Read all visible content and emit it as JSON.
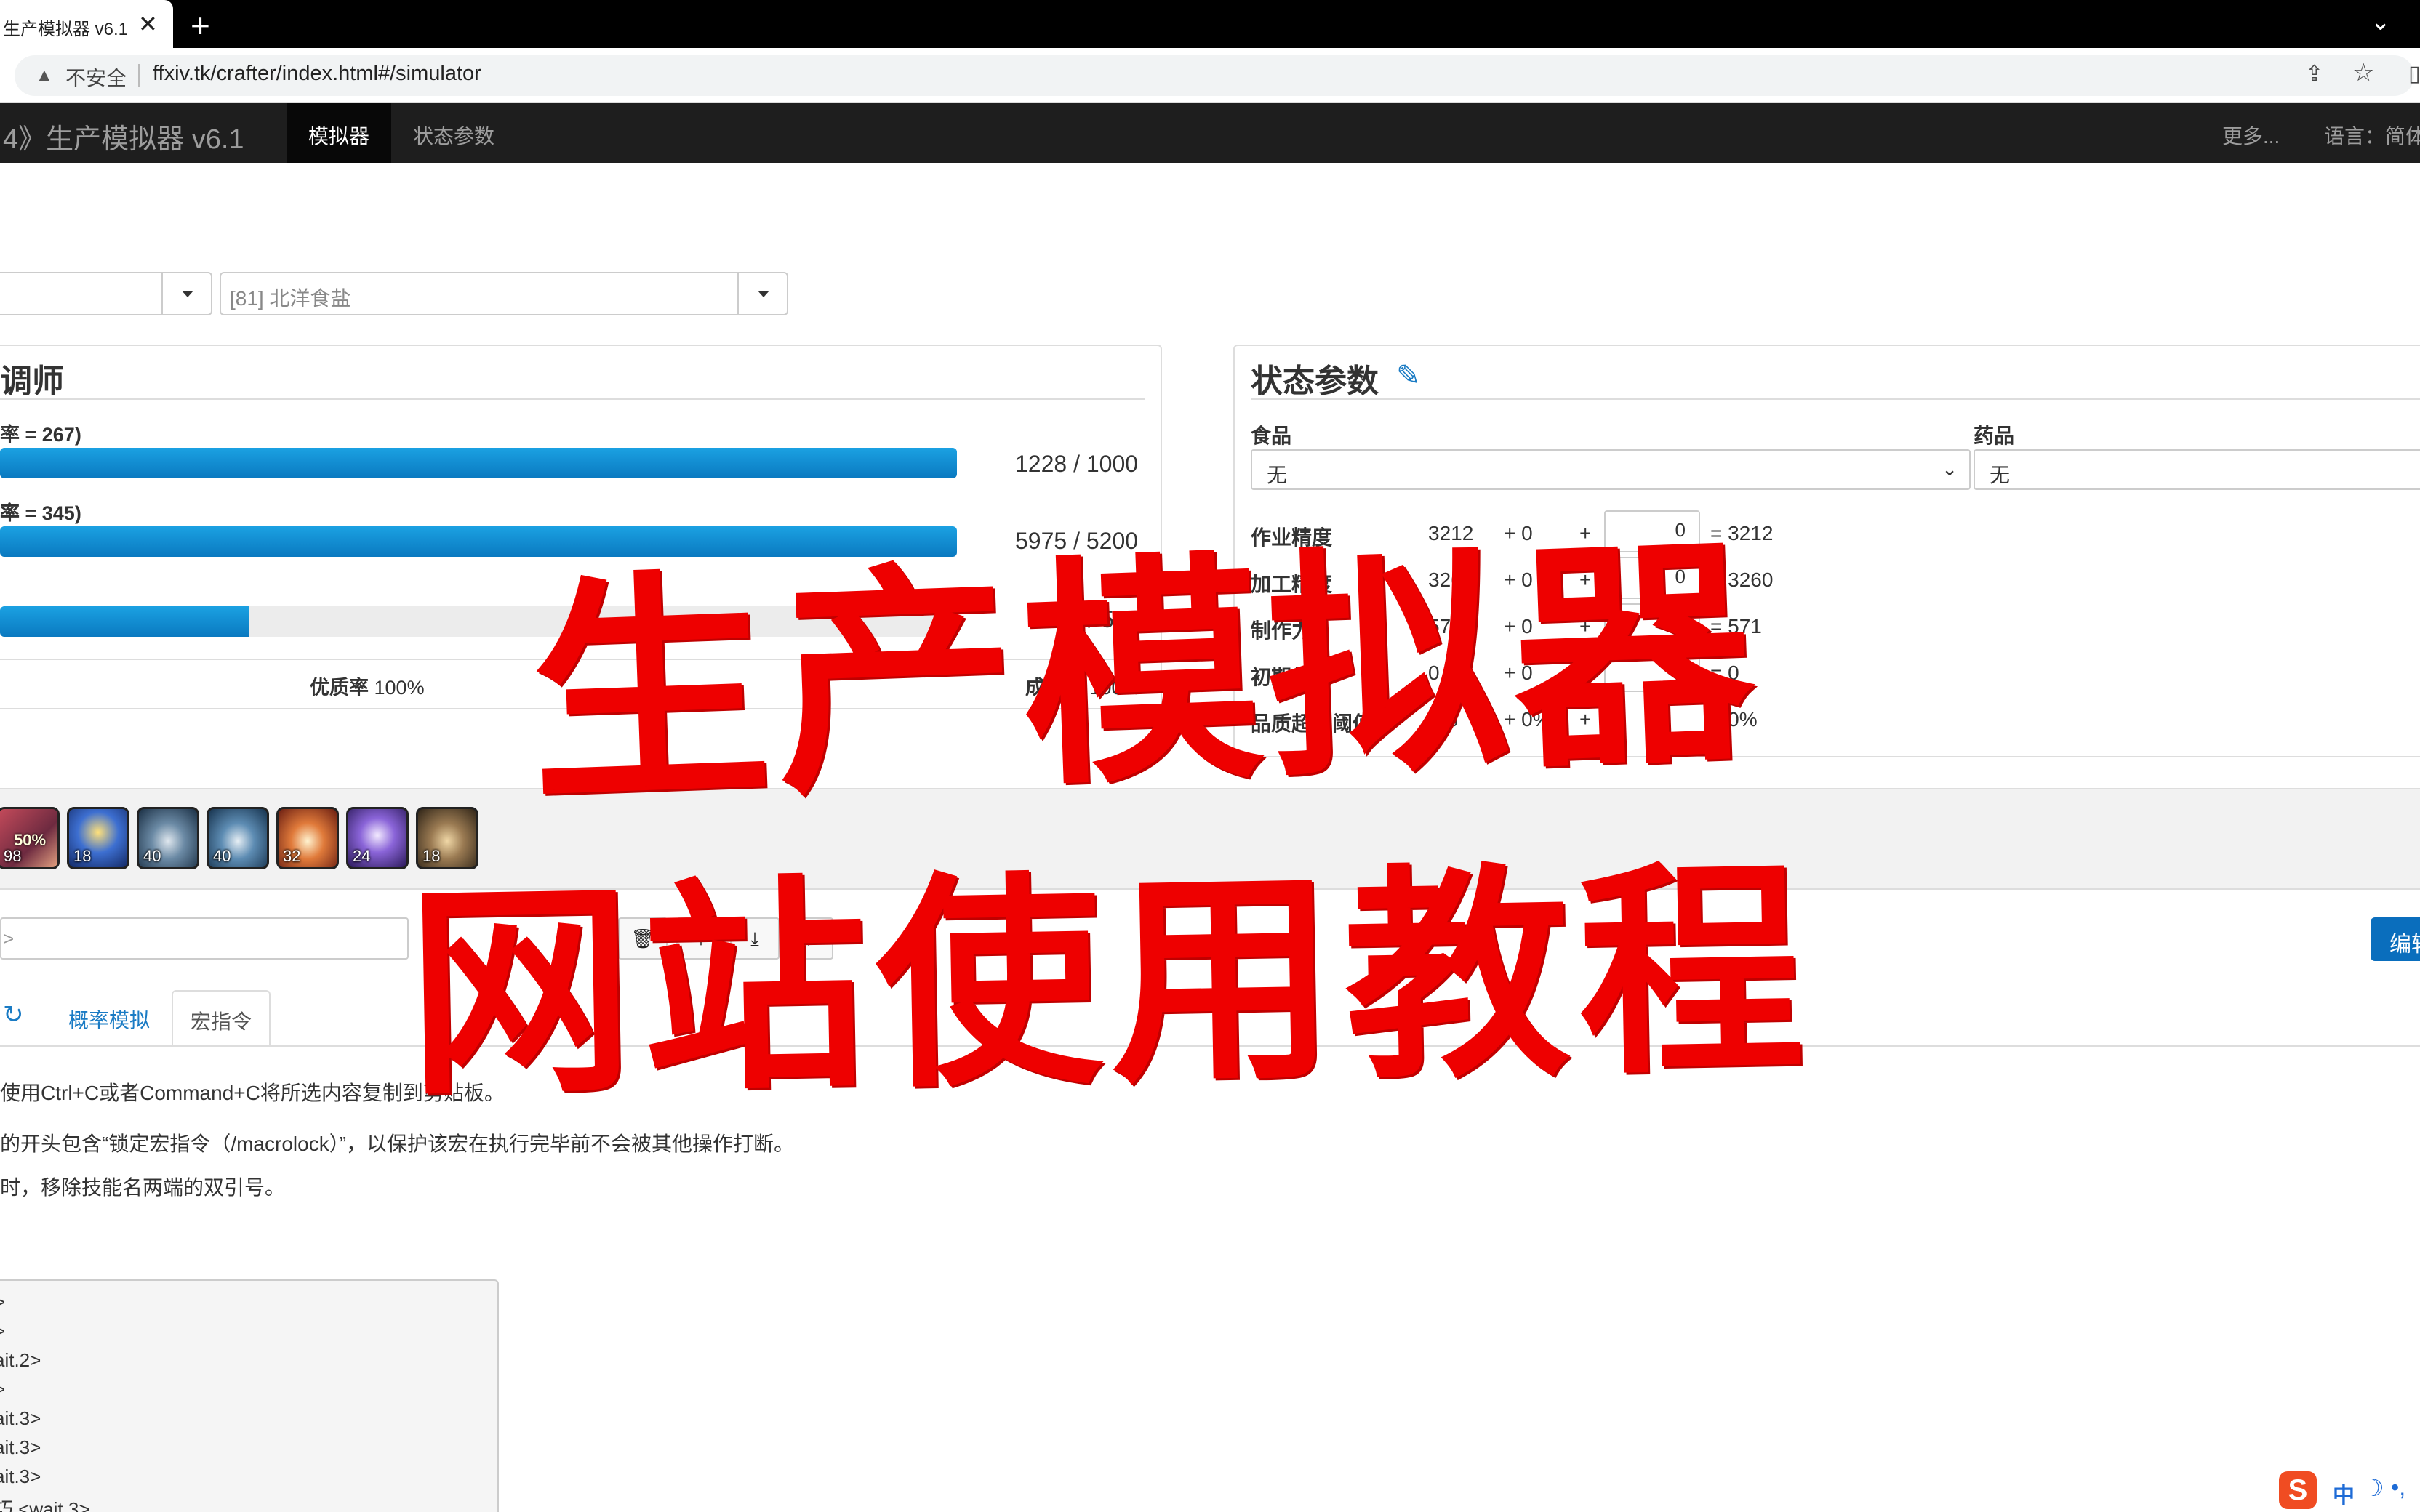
{
  "browser": {
    "tab_title": "生产模拟器 v6.1",
    "close_glyph": "✕",
    "new_tab_glyph": "+",
    "tab_menu_glyph": "⌄",
    "security_text": "不安全",
    "url": "ffxiv.tk/crafter/index.html#/simulator"
  },
  "nav": {
    "brand": "4》生产模拟器 v6.1",
    "simulator": "模拟器",
    "stats": "状态参数",
    "more": "更多...",
    "language": "语言：简体"
  },
  "selects": {
    "recipe": "[81] 北洋食盐"
  },
  "craft_panel": {
    "title": "调师",
    "progress_label": "率 = 267)",
    "progress_value": "1228 / 1000",
    "progress_fraction": 1.0,
    "quality_label": "率 = 345)",
    "quality_value": "5975 / 5200",
    "quality_fraction": 1.0,
    "third_value": "139 / 5",
    "third_fraction": 0.26,
    "hq_label": "优质率",
    "hq_value": "100%",
    "success_label": "成功率",
    "success_value": "100%"
  },
  "stats_panel": {
    "title": "状态参数",
    "food_label": "食品",
    "food_value": "无",
    "medicine_label": "药品",
    "medicine_value": "无",
    "rows": [
      {
        "name": "作业精度",
        "base": "3212",
        "plus": "+ 0",
        "input": "0",
        "total": "3212"
      },
      {
        "name": "加工精度",
        "base": "3260",
        "plus": "+ 0",
        "input": "0",
        "total": "3260"
      },
      {
        "name": "制作力",
        "base": "571",
        "plus": "+ 0",
        "input": "0",
        "total": "571"
      },
      {
        "name": "初期品质",
        "base": "0",
        "plus": "+ 0",
        "input": "0",
        "total": "0"
      },
      {
        "name": "品质超限阈值",
        "base": "0%",
        "plus": "+ 0%",
        "input": "0",
        "total": "0%"
      }
    ]
  },
  "skills": [
    {
      "icon": "manipulation-icon",
      "count": "98"
    },
    {
      "icon": "veneration-icon",
      "count": "18"
    },
    {
      "icon": "basic-synthesis-icon",
      "count": "40"
    },
    {
      "icon": "careful-synthesis-icon",
      "count": "40"
    },
    {
      "icon": "groundwork-icon",
      "count": "32"
    },
    {
      "icon": "innovation-icon",
      "count": "24"
    },
    {
      "icon": "basic-touch-icon",
      "count": "18"
    }
  ],
  "toolbar": {
    "macro_placeholder": ">",
    "edit_label": "编辑"
  },
  "tabs": {
    "probability": "概率模拟",
    "macro": "宏指令"
  },
  "notes": [
    "使用Ctrl+C或者Command+C将所选内容复制到剪贴板。",
    "的开头包含“锁定宏指令（/macrolock）”，以保护该宏在执行完毕前不会被其他操作打断。",
    "时，移除技能名两端的双引号。"
  ],
  "macro_lines": [
    ">",
    ">",
    "ait.2>",
    ">",
    "ait.3>",
    "ait.3>",
    "ait.3>",
    "巧 <wait.3>"
  ],
  "ime": {
    "logo": "S",
    "lang": "中",
    "moon": "☽",
    "dots": "•,"
  },
  "overlay": {
    "line1": "生产模拟器",
    "line2": "网站使用教程"
  },
  "colors": {
    "bar": "#1a8ad4",
    "overlay": "#ee0000",
    "navbar": "#1e1e1e"
  }
}
